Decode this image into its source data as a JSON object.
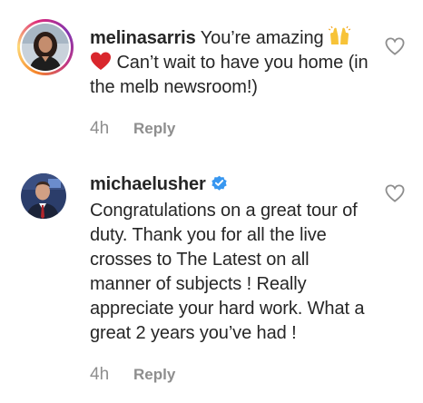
{
  "comments": [
    {
      "username": "melinasarris",
      "text_before_emoji": "You’re amazing ",
      "text_after_emoji": " Can’t wait to have you home (in the melb newsroom!)",
      "emoji_1": "🙌",
      "emoji_2": "❤️",
      "time": "4h",
      "reply_label": "Reply",
      "verified": false
    },
    {
      "username": "michaelusher",
      "text": "Congratulations on a great tour of duty. Thank you for all the live crosses to The Latest on all manner of subjects ! Really appreciate your hard work. What a great 2 years you’ve had !",
      "time": "4h",
      "reply_label": "Reply",
      "verified": true
    }
  ],
  "colors": {
    "text": "#262626",
    "meta": "#8e8e8e",
    "verified_badge": "#3897f0",
    "heart_outline": "#8e8e8e",
    "emoji_yellow": "#f7c338",
    "emoji_red": "#d9262c"
  },
  "icons": {
    "like": "heart-outline-icon",
    "verified": "verified-badge-icon"
  }
}
